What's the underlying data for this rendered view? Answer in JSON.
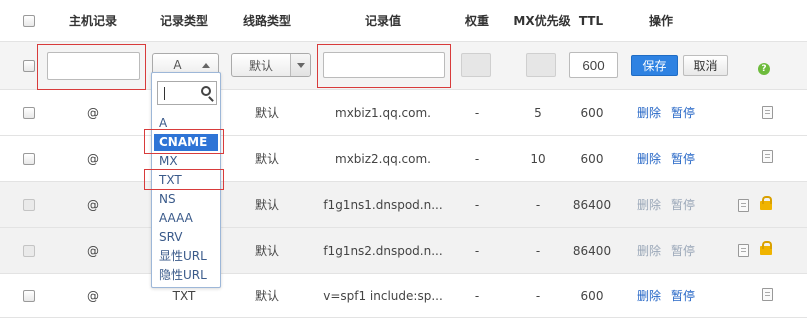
{
  "header": {
    "host": "主机记录",
    "type": "记录类型",
    "line": "线路类型",
    "value": "记录值",
    "weight": "权重",
    "mx": "MX优先级",
    "ttl": "TTL",
    "action": "操作"
  },
  "edit_row": {
    "host_value": "",
    "type_value": "A",
    "line_value": "默认",
    "record_value": "",
    "weight_value": "",
    "mx_value": "",
    "ttl_value": "600",
    "save_label": "保存",
    "cancel_label": "取消",
    "help_label": "?"
  },
  "dropdown": {
    "search_value": "",
    "options": [
      "A",
      "CNAME",
      "MX",
      "TXT",
      "NS",
      "AAAA",
      "SRV",
      "显性URL",
      "隐性URL"
    ],
    "highlighted": "CNAME"
  },
  "rows": [
    {
      "host": "@",
      "type": "",
      "line": "默认",
      "value": "mxbiz1.qq.com.",
      "weight": "-",
      "mx": "5",
      "ttl": "600",
      "delete": "删除",
      "pause": "暂停",
      "locked": false
    },
    {
      "host": "@",
      "type": "",
      "line": "默认",
      "value": "mxbiz2.qq.com.",
      "weight": "-",
      "mx": "10",
      "ttl": "600",
      "delete": "删除",
      "pause": "暂停",
      "locked": false
    },
    {
      "host": "@",
      "type": "",
      "line": "默认",
      "value": "f1g1ns1.dnspod.n...",
      "weight": "-",
      "mx": "-",
      "ttl": "86400",
      "delete": "删除",
      "pause": "暂停",
      "locked": true
    },
    {
      "host": "@",
      "type": "",
      "line": "默认",
      "value": "f1g1ns2.dnspod.n...",
      "weight": "-",
      "mx": "-",
      "ttl": "86400",
      "delete": "删除",
      "pause": "暂停",
      "locked": true
    },
    {
      "host": "@",
      "type": "TXT",
      "line": "默认",
      "value": "v=spf1 include:sp...",
      "weight": "-",
      "mx": "-",
      "ttl": "600",
      "delete": "删除",
      "pause": "暂停",
      "locked": false
    }
  ],
  "colors": {
    "accent": "#2e82e2",
    "link": "#2566c6",
    "highlight_border": "#d83b3b",
    "lock": "#f0b400",
    "help": "#6dbb3c"
  }
}
